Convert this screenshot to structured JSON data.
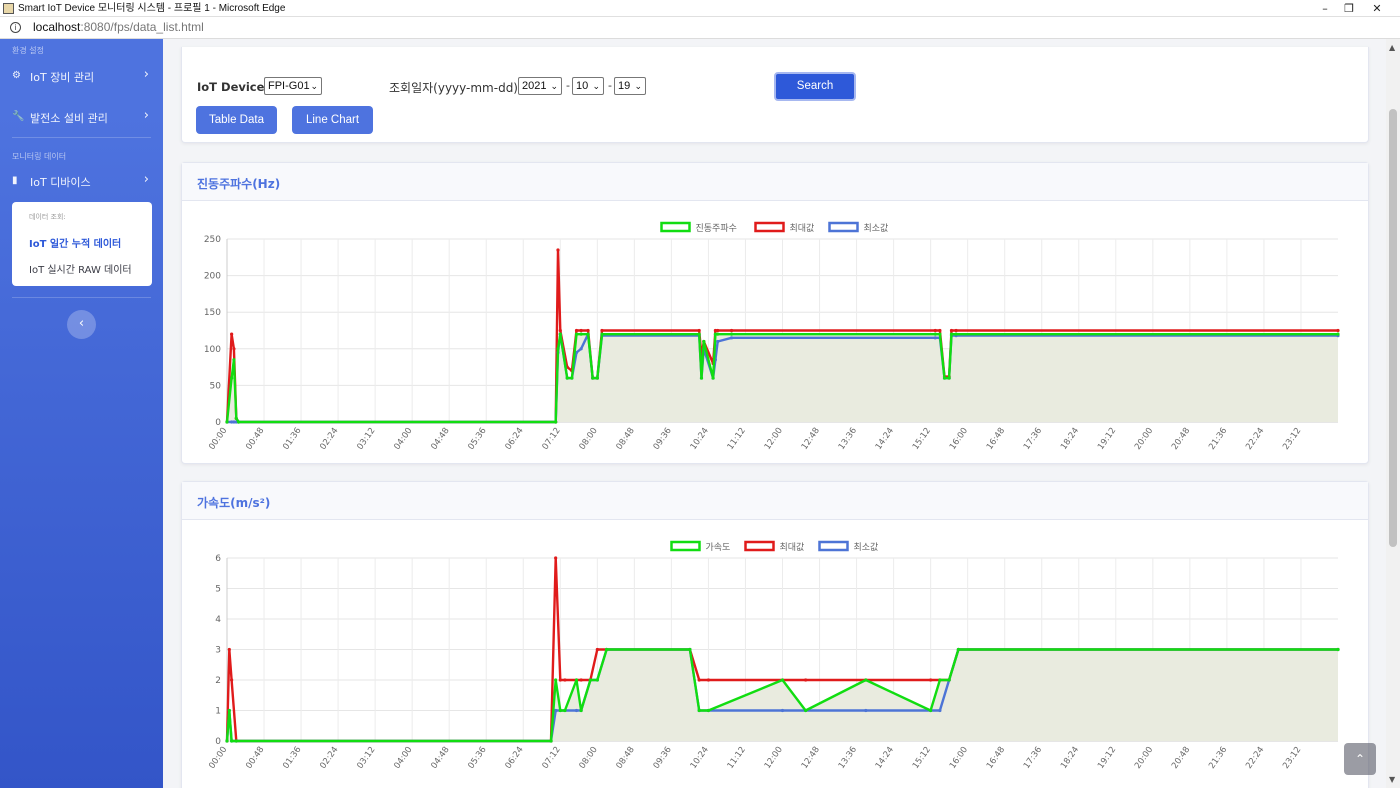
{
  "window": {
    "title": "Smart IoT Device 모니터링 시스템 - 프로필 1 - Microsoft Edge"
  },
  "browser": {
    "url_host": "localhost",
    "url_rest": ":8080/fps/data_list.html"
  },
  "sidebar": {
    "heading_settings": "환경 설정",
    "items": [
      {
        "label": "IoT 장비 관리",
        "icon": "gear-icon"
      },
      {
        "label": "발전소 설비 관리",
        "icon": "wrench-icon"
      }
    ],
    "heading_monitoring": "모니터링 데이터",
    "iot_device_item": {
      "label": "IoT 디바이스",
      "icon": "folder-icon"
    },
    "submenu": {
      "heading": "데이터 조회:",
      "items": [
        {
          "label": "IoT 일간 누적 데이터",
          "active": true
        },
        {
          "label": "IoT 실시간 RAW 데이터",
          "active": false
        }
      ]
    }
  },
  "filter": {
    "device_label": "IoT Device :",
    "device_value": "FPI-G01",
    "date_label": "조회일자(yyyy-mm-dd) :",
    "year": "2021",
    "month": "10",
    "day": "19",
    "dash": "-",
    "search_label": "Search",
    "table_button": "Table Data",
    "chart_button": "Line Chart"
  },
  "colors": {
    "accent": "#4e73df",
    "series_main": "#11dd11",
    "series_max": "#e01b1b",
    "series_min": "#4d74d6",
    "fill": "#e9ebdf"
  },
  "chart_data": [
    {
      "type": "line",
      "title": "진동주파수(Hz)",
      "xlabel": "",
      "ylabel": "",
      "ylim": [
        0,
        250
      ],
      "yticks": [
        0,
        50,
        100,
        150,
        200,
        250
      ],
      "x_unit": "hour",
      "xticks": [
        "00:00",
        "00:48",
        "01:36",
        "02:24",
        "03:12",
        "04:00",
        "04:48",
        "05:36",
        "06:24",
        "07:12",
        "08:00",
        "08:48",
        "09:36",
        "10:24",
        "11:12",
        "12:00",
        "12:48",
        "13:36",
        "14:24",
        "15:12",
        "16:00",
        "16:48",
        "17:36",
        "18:24",
        "19:12",
        "20:00",
        "20:48",
        "21:36",
        "22:24",
        "23:12"
      ],
      "legend": "top-center",
      "grid": true,
      "series": [
        {
          "name": "진동주파수",
          "color": "#11dd11",
          "fill": true,
          "x": [
            0,
            0.1,
            0.15,
            0.2,
            0.25,
            7.1,
            7.15,
            7.2,
            7.35,
            7.45,
            7.55,
            7.65,
            7.8,
            7.9,
            8.0,
            8.1,
            10.2,
            10.25,
            10.3,
            10.5,
            10.55,
            10.6,
            10.9,
            15.3,
            15.4,
            15.5,
            15.6,
            15.65,
            15.75,
            24
          ],
          "y": [
            0,
            60,
            85,
            5,
            0,
            0,
            100,
            120,
            60,
            60,
            120,
            120,
            120,
            60,
            60,
            120,
            120,
            60,
            110,
            60,
            120,
            120,
            120,
            120,
            120,
            60,
            60,
            120,
            120,
            120
          ]
        },
        {
          "name": "최대값",
          "color": "#e01b1b",
          "fill": false,
          "x": [
            0,
            0.1,
            0.15,
            0.2,
            0.25,
            7.1,
            7.15,
            7.2,
            7.35,
            7.45,
            7.55,
            7.65,
            7.8,
            7.9,
            8.0,
            8.1,
            10.2,
            10.25,
            10.3,
            10.5,
            10.55,
            10.6,
            10.9,
            15.3,
            15.4,
            15.5,
            15.6,
            15.65,
            15.75,
            24
          ],
          "y": [
            0,
            120,
            100,
            5,
            0,
            0,
            235,
            125,
            75,
            70,
            125,
            125,
            125,
            60,
            60,
            125,
            125,
            90,
            110,
            80,
            125,
            125,
            125,
            125,
            125,
            62,
            62,
            125,
            125,
            125
          ]
        },
        {
          "name": "최소값",
          "color": "#4d74d6",
          "fill": false,
          "x": [
            0,
            0.1,
            0.15,
            0.2,
            0.25,
            7.1,
            7.15,
            7.2,
            7.35,
            7.45,
            7.55,
            7.65,
            7.8,
            7.9,
            8.0,
            8.1,
            10.2,
            10.25,
            10.3,
            10.5,
            10.55,
            10.6,
            10.9,
            15.3,
            15.4,
            15.5,
            15.6,
            15.65,
            15.75,
            24
          ],
          "y": [
            0,
            0,
            0,
            0,
            0,
            0,
            95,
            120,
            60,
            60,
            95,
            100,
            120,
            60,
            60,
            118,
            118,
            60,
            100,
            60,
            85,
            110,
            115,
            115,
            115,
            60,
            60,
            118,
            118,
            118
          ]
        }
      ]
    },
    {
      "type": "line",
      "title": "가속도(m/s²)",
      "xlabel": "",
      "ylabel": "",
      "ylim": [
        0,
        6
      ],
      "yticks": [
        0,
        1,
        2,
        3,
        4,
        5,
        6
      ],
      "x_unit": "hour",
      "xticks": [
        "00:00",
        "00:48",
        "01:36",
        "02:24",
        "03:12",
        "04:00",
        "04:48",
        "05:36",
        "06:24",
        "07:12",
        "08:00",
        "08:48",
        "09:36",
        "10:24",
        "11:12",
        "12:00",
        "12:48",
        "13:36",
        "14:24",
        "15:12",
        "16:00",
        "16:48",
        "17:36",
        "18:24",
        "19:12",
        "20:00",
        "20:48",
        "21:36",
        "22:24",
        "23:12"
      ],
      "legend": "top-center",
      "grid": true,
      "series": [
        {
          "name": "가속도",
          "color": "#11dd11",
          "fill": true,
          "x": [
            0,
            0.05,
            0.1,
            0.2,
            7.0,
            7.1,
            7.2,
            7.3,
            7.55,
            7.65,
            7.85,
            8.0,
            8.2,
            10.0,
            10.2,
            10.4,
            12.0,
            12.5,
            13.8,
            15.2,
            15.4,
            15.6,
            15.8,
            24
          ],
          "y": [
            0,
            1,
            0,
            0,
            0,
            2,
            1,
            1,
            2,
            1,
            2,
            2,
            3,
            3,
            1,
            1,
            2,
            1,
            2,
            1,
            2,
            2,
            3,
            3
          ]
        },
        {
          "name": "최대값",
          "color": "#e01b1b",
          "fill": false,
          "x": [
            0,
            0.05,
            0.1,
            0.2,
            7.0,
            7.1,
            7.2,
            7.3,
            7.55,
            7.65,
            7.85,
            8.0,
            8.2,
            10.0,
            10.2,
            10.4,
            12.0,
            12.5,
            13.8,
            15.2,
            15.4,
            15.6,
            15.8,
            24
          ],
          "y": [
            0,
            3,
            2,
            0,
            0,
            6,
            2,
            2,
            2,
            2,
            2,
            3,
            3,
            3,
            2,
            2,
            2,
            2,
            2,
            2,
            2,
            2,
            3,
            3
          ]
        },
        {
          "name": "최소값",
          "color": "#4d74d6",
          "fill": false,
          "x": [
            0,
            0.05,
            0.1,
            0.2,
            7.0,
            7.1,
            7.2,
            7.3,
            7.55,
            7.65,
            7.85,
            8.0,
            8.2,
            10.0,
            10.2,
            10.4,
            12.0,
            12.5,
            13.8,
            15.2,
            15.4,
            15.6,
            15.8,
            24
          ],
          "y": [
            0,
            1,
            0,
            0,
            0,
            1,
            1,
            1,
            1,
            1,
            2,
            2,
            3,
            3,
            1,
            1,
            1,
            1,
            1,
            1,
            1,
            2,
            3,
            3
          ]
        }
      ]
    }
  ]
}
